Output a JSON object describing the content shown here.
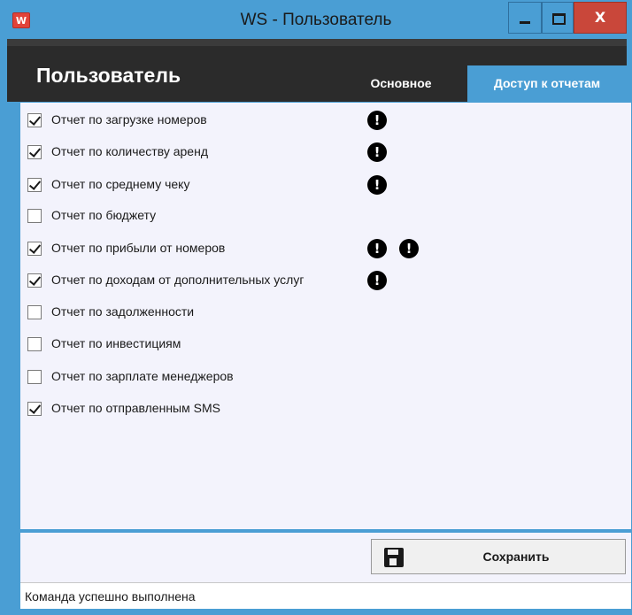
{
  "window": {
    "title": "WS - Пользователь",
    "app_icon_letter": "W",
    "controls": {
      "minimize": "minimize-icon",
      "maximize": "maximize-icon",
      "close_label": "X"
    }
  },
  "header": {
    "title": "Пользователь",
    "tabs": [
      {
        "label": "Основное",
        "active": false
      },
      {
        "label": "Доступ к отчетам",
        "active": true
      }
    ]
  },
  "reports": [
    {
      "label": "Отчет по загрузке номеров",
      "checked": true,
      "warnings": 1
    },
    {
      "label": "Отчет по количеству аренд",
      "checked": true,
      "warnings": 1
    },
    {
      "label": "Отчет по среднему чеку",
      "checked": true,
      "warnings": 1
    },
    {
      "label": "Отчет по бюджету",
      "checked": false,
      "warnings": 0
    },
    {
      "label": "Отчет по прибыли от номеров",
      "checked": true,
      "warnings": 2
    },
    {
      "label": "Отчет по доходам от дополнительных услуг",
      "checked": true,
      "warnings": 1
    },
    {
      "label": "Отчет по задолженности",
      "checked": false,
      "warnings": 0
    },
    {
      "label": "Отчет по инвестициям",
      "checked": false,
      "warnings": 0
    },
    {
      "label": "Отчет по зарплате менеджеров",
      "checked": false,
      "warnings": 0
    },
    {
      "label": "Отчет по отправленным SMS",
      "checked": true,
      "warnings": 0
    }
  ],
  "warning_glyph": "!",
  "save_button": {
    "label": "Сохранить",
    "icon": "floppy-disk-icon"
  },
  "status": {
    "text": "Команда успешно выполнена"
  },
  "colors": {
    "accent": "#4a9ed4",
    "header_bg": "#2b2b2b",
    "close_red": "#c9473a",
    "content_bg": "#f3f3fc"
  }
}
